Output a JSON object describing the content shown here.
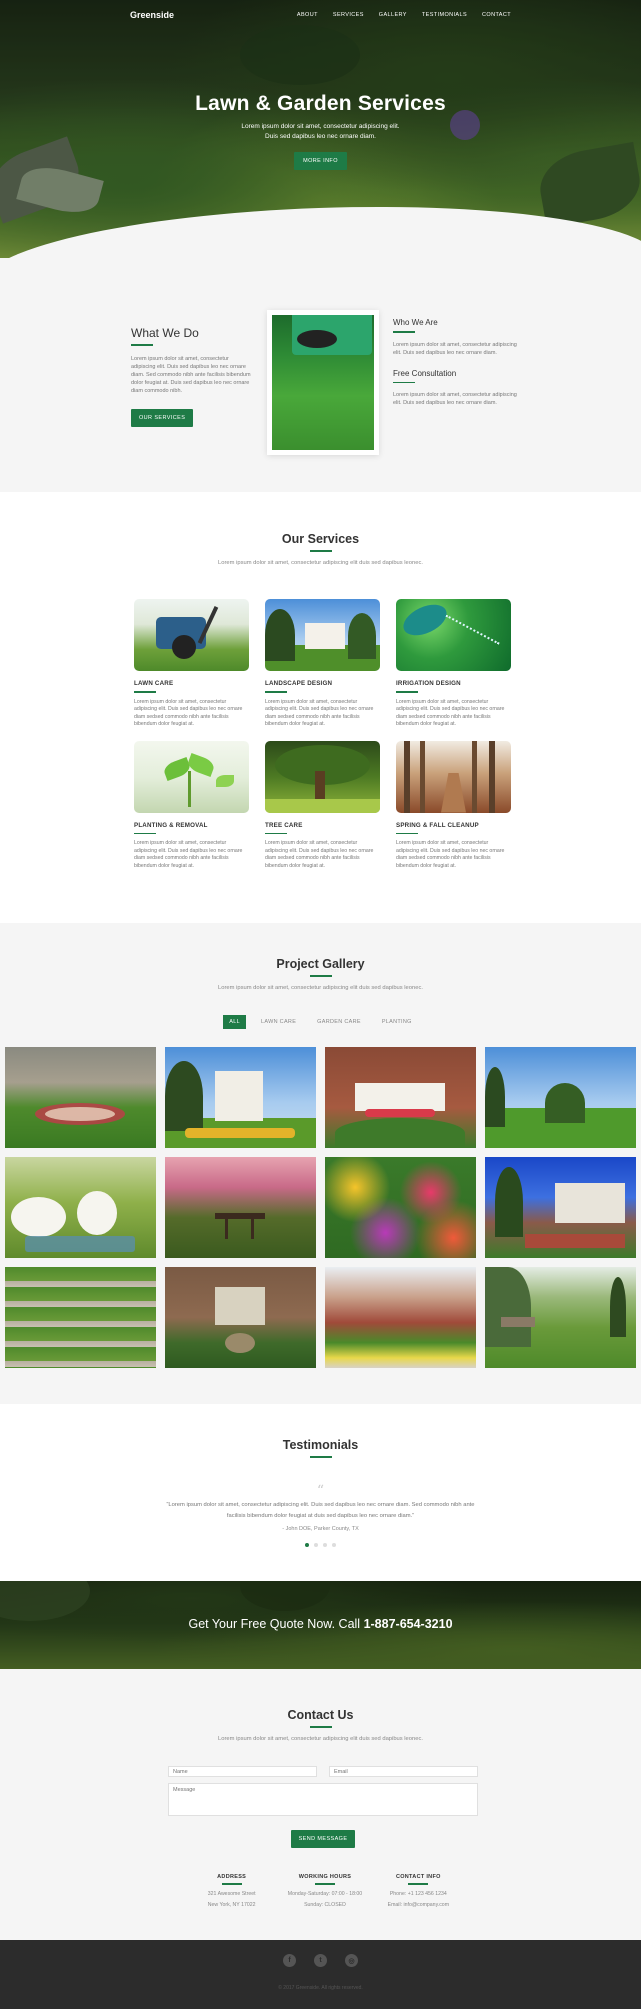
{
  "nav": {
    "brand": "Greenside",
    "items": [
      "ABOUT",
      "SERVICES",
      "GALLERY",
      "TESTIMONIALS",
      "CONTACT"
    ]
  },
  "hero": {
    "title": "Lawn & Garden Services",
    "subtitle_line1": "Lorem ipsum dolor sit amet, consectetur adipiscing elit.",
    "subtitle_line2": "Duis sed dapibus leo nec ornare diam.",
    "button": "MORE INFO"
  },
  "what_we_do": {
    "title": "What We Do",
    "text": "Lorem ipsum dolor sit amet, consectetur adipiscing elit. Duis sed dapibus leo nec ornare diam. Sed commodo nibh ante facilisis bibendum dolor feugiat at. Duis sed dapibus leo nec ornare diam commodo nibh.",
    "button": "OUR SERVICES",
    "who_title": "Who We Are",
    "who_text": "Lorem ipsum dolor sit amet, consectetur adipiscing elit. Duis sed dapibus leo nec ornare diam.",
    "consult_title": "Free Consultation",
    "consult_text": "Lorem ipsum dolor sit amet, consectetur adipiscing elit. Duis sed dapibus leo nec ornare diam."
  },
  "services": {
    "title": "Our Services",
    "subtitle": "Lorem ipsum dolor sit amet, consectetur adipiscing elit duis sed dapibus leonec.",
    "items": [
      {
        "title": "LAWN CARE",
        "text": "Lorem ipsum dolor sit amet, consectetur adipiscing elit. Duis sed dapibus leo nec ornare diam sedsed commodo nibh ante facilisis bibendum dolor feugiat at."
      },
      {
        "title": "LANDSCAPE DESIGN",
        "text": "Lorem ipsum dolor sit amet, consectetur adipiscing elit. Duis sed dapibus leo nec ornare diam sedsed commodo nibh ante facilisis bibendum dolor feugiat at."
      },
      {
        "title": "IRRIGATION DESIGN",
        "text": "Lorem ipsum dolor sit amet, consectetur adipiscing elit. Duis sed dapibus leo nec ornare diam sedsed commodo nibh ante facilisis bibendum dolor feugiat at."
      },
      {
        "title": "PLANTING & REMOVAL",
        "text": "Lorem ipsum dolor sit amet, consectetur adipiscing elit. Duis sed dapibus leo nec ornare diam sedsed commodo nibh ante facilisis bibendum dolor feugiat at."
      },
      {
        "title": "TREE CARE",
        "text": "Lorem ipsum dolor sit amet, consectetur adipiscing elit. Duis sed dapibus leo nec ornare diam sedsed commodo nibh ante facilisis bibendum dolor feugiat at."
      },
      {
        "title": "SPRING & FALL CLEANUP",
        "text": "Lorem ipsum dolor sit amet, consectetur adipiscing elit. Duis sed dapibus leo nec ornare diam sedsed commodo nibh ante facilisis bibendum dolor feugiat at."
      }
    ]
  },
  "gallery": {
    "title": "Project Gallery",
    "subtitle": "Lorem ipsum dolor sit amet, consectetur adipiscing elit duis sed dapibus leonec.",
    "filters": [
      "ALL",
      "LAWN CARE",
      "GARDEN CARE",
      "PLANTING"
    ],
    "active_filter": "ALL"
  },
  "testimonials": {
    "title": "Testimonials",
    "quote_mark": "“",
    "quote": "“Lorem ipsum dolor sit amet, consectetur adipiscing elit. Duis sed dapibus leo nec ornare diam. Sed commodo nibh ante facilisis bibendum dolor feugiat at duis sed dapibus leo nec ornare diam.”",
    "author": "- John DOE, Parker County, TX",
    "slides": 4,
    "active_slide": 1
  },
  "cta": {
    "text": "Get Your Free Quote Now. Call ",
    "phone": "1-887-654-3210"
  },
  "contact": {
    "title": "Contact Us",
    "subtitle": "Lorem ipsum dolor sit amet, consectetur adipiscing elit duis sed dapibus leonec.",
    "name_placeholder": "Name",
    "email_placeholder": "Email",
    "message_placeholder": "Message",
    "button": "SEND MESSAGE",
    "address_title": "ADDRESS",
    "address_line1": "321 Awesome Street",
    "address_line2": "New York, NY 17022",
    "hours_title": "WORKING HOURS",
    "hours_line1": "Monday-Saturday: 07:00 - 18:00",
    "hours_line2": "Sunday: CLOSED",
    "info_title": "CONTACT INFO",
    "info_line1": "Phone: +1 123 456 1234",
    "info_line2": "Email: info@company.com"
  },
  "footer": {
    "socials": [
      "facebook-icon",
      "twitter-icon",
      "instagram-icon"
    ],
    "social_glyphs": [
      "f",
      "t",
      "◎"
    ],
    "copyright": "© 2017 Greenside. All rights reserved."
  },
  "colors": {
    "accent": "#1e7b46",
    "section_bg": "#f5f5f5",
    "footer_bg": "#2c2c2c"
  }
}
